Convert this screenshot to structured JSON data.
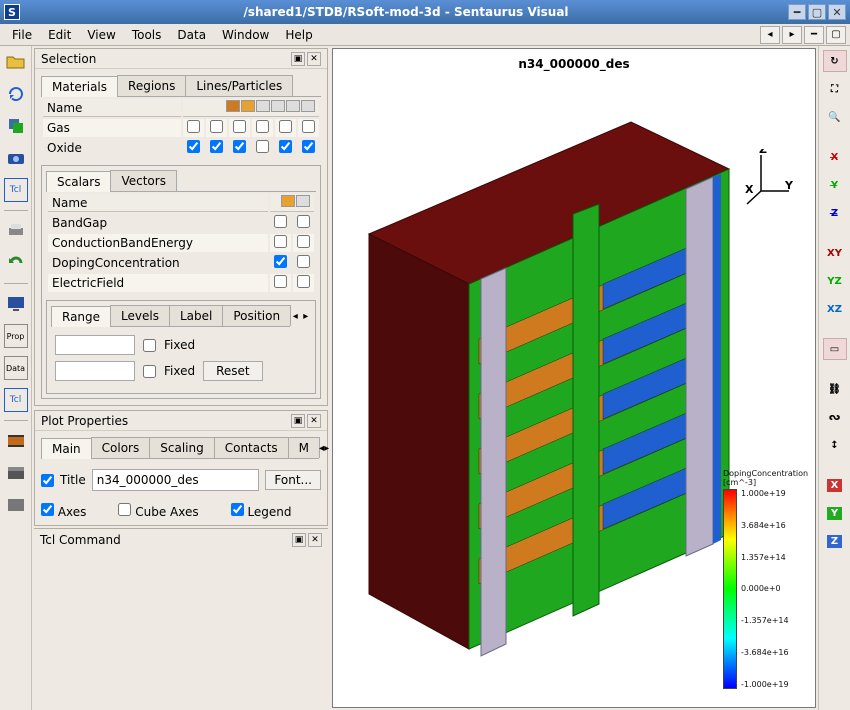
{
  "window": {
    "app_icon_letter": "S",
    "title": "/shared1/STDB/RSoft-mod-3d - Sentaurus Visual"
  },
  "menubar": {
    "items": [
      "File",
      "Edit",
      "View",
      "Tools",
      "Data",
      "Window",
      "Help"
    ]
  },
  "panels": {
    "selection": {
      "title": "Selection",
      "tabs": [
        "Materials",
        "Regions",
        "Lines/Particles"
      ],
      "active_tab": 0,
      "materials_header": "Name",
      "materials": [
        {
          "name": "Gas",
          "checks": [
            false,
            false,
            false,
            false,
            false,
            false
          ]
        },
        {
          "name": "Oxide",
          "checks": [
            true,
            true,
            true,
            false,
            true,
            true
          ]
        }
      ],
      "scalars_tabs": [
        "Scalars",
        "Vectors"
      ],
      "scalars_active": 0,
      "scalars_header": "Name",
      "scalars": [
        {
          "name": "BandGap",
          "checks": [
            false,
            false
          ]
        },
        {
          "name": "ConductionBandEnergy",
          "checks": [
            false,
            false
          ]
        },
        {
          "name": "DopingConcentration",
          "checks": [
            true,
            false
          ]
        },
        {
          "name": "ElectricField",
          "checks": [
            false,
            false
          ]
        }
      ],
      "range_tabs": [
        "Range",
        "Levels",
        "Label",
        "Position"
      ],
      "range_active": 0,
      "range": {
        "min": "",
        "max": "",
        "fixed_label": "Fixed",
        "reset_label": "Reset"
      }
    },
    "plot_properties": {
      "title": "Plot Properties",
      "tabs": [
        "Main",
        "Colors",
        "Scaling",
        "Contacts",
        "M"
      ],
      "active_tab": 0,
      "title_checkbox": "Title",
      "title_value": "n34_000000_des",
      "font_button": "Font...",
      "axes_label": "Axes",
      "cube_axes_label": "Cube Axes",
      "legend_label": "Legend",
      "axes_checked": true,
      "cube_axes_checked": false,
      "legend_checked": true,
      "title_checked": true
    },
    "tcl_command": {
      "title": "Tcl Command"
    }
  },
  "viewer": {
    "plot_title": "n34_000000_des",
    "axes_labels": {
      "x": "X",
      "y": "Y",
      "z": "Z"
    },
    "legend": {
      "title": "DopingConcentration [cm^-3]",
      "ticks": [
        "1.000e+19",
        "3.684e+16",
        "1.357e+14",
        "0.000e+0",
        "-1.357e+14",
        "-3.684e+16",
        "-1.000e+19"
      ]
    }
  },
  "colors": {
    "solid_top": "#6a0e0e",
    "solid_side": "#4d0a0a",
    "green": "#1fa81f",
    "orange": "#d07a1f",
    "blue": "#1f5fd0",
    "grey": "#b9b1c7"
  }
}
